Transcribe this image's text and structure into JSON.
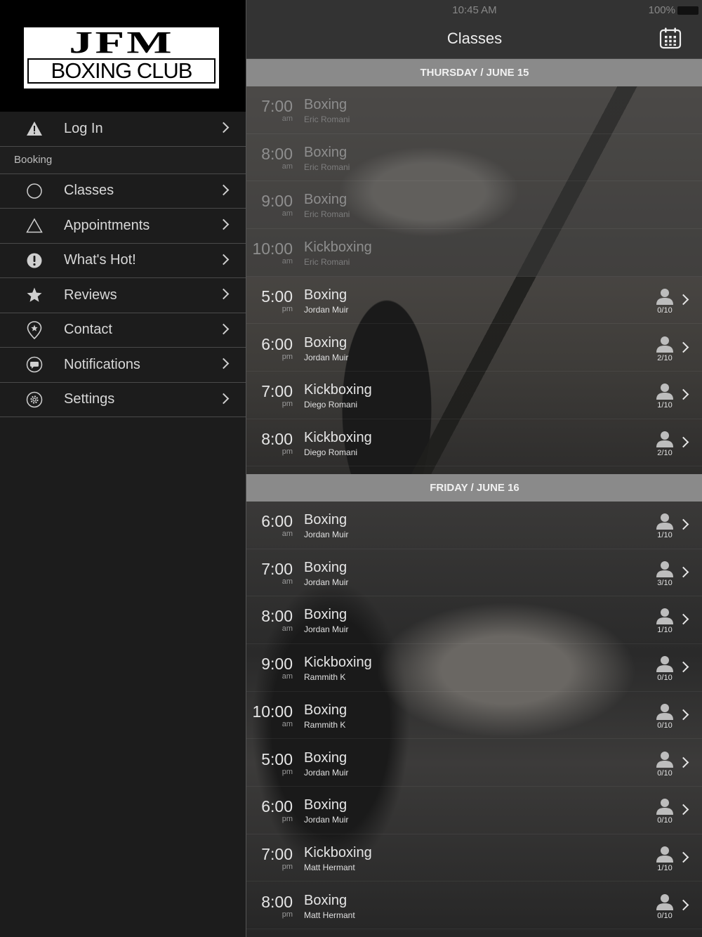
{
  "status_bar": {
    "time": "10:45 AM",
    "battery": "100%"
  },
  "sidebar": {
    "logo": {
      "line1": "JFM",
      "line2": "BOXING CLUB"
    },
    "login": {
      "label": "Log In",
      "icon": "warning-icon"
    },
    "section_label": "Booking",
    "items": [
      {
        "label": "Classes",
        "icon": "circle-icon"
      },
      {
        "label": "Appointments",
        "icon": "triangle-icon"
      },
      {
        "label": "What's Hot!",
        "icon": "exclamation-icon"
      },
      {
        "label": "Reviews",
        "icon": "star-icon"
      },
      {
        "label": "Contact",
        "icon": "map-pin-icon"
      },
      {
        "label": "Notifications",
        "icon": "chat-bubble-icon"
      },
      {
        "label": "Settings",
        "icon": "gear-icon"
      }
    ]
  },
  "main": {
    "title": "Classes",
    "days": [
      {
        "header": "THURSDAY / JUNE 15",
        "classes": [
          {
            "time": "7:00",
            "ampm": "am",
            "name": "Boxing",
            "instructor": "Eric Romani",
            "past": true
          },
          {
            "time": "8:00",
            "ampm": "am",
            "name": "Boxing",
            "instructor": "Eric Romani",
            "past": true
          },
          {
            "time": "9:00",
            "ampm": "am",
            "name": "Boxing",
            "instructor": "Eric Romani",
            "past": true
          },
          {
            "time": "10:00",
            "ampm": "am",
            "name": "Kickboxing",
            "instructor": "Eric Romani",
            "past": true
          },
          {
            "time": "5:00",
            "ampm": "pm",
            "name": "Boxing",
            "instructor": "Jordan Muir",
            "booked": "0/10"
          },
          {
            "time": "6:00",
            "ampm": "pm",
            "name": "Boxing",
            "instructor": "Jordan Muir",
            "booked": "2/10"
          },
          {
            "time": "7:00",
            "ampm": "pm",
            "name": "Kickboxing",
            "instructor": "Diego Romani",
            "booked": "1/10"
          },
          {
            "time": "8:00",
            "ampm": "pm",
            "name": "Kickboxing",
            "instructor": "Diego Romani",
            "booked": "2/10"
          }
        ]
      },
      {
        "header": "FRIDAY / JUNE 16",
        "classes": [
          {
            "time": "6:00",
            "ampm": "am",
            "name": "Boxing",
            "instructor": "Jordan Muir",
            "booked": "1/10"
          },
          {
            "time": "7:00",
            "ampm": "am",
            "name": "Boxing",
            "instructor": "Jordan Muir",
            "booked": "3/10"
          },
          {
            "time": "8:00",
            "ampm": "am",
            "name": "Boxing",
            "instructor": "Jordan Muir",
            "booked": "1/10"
          },
          {
            "time": "9:00",
            "ampm": "am",
            "name": "Kickboxing",
            "instructor": "Rammith K",
            "booked": "0/10"
          },
          {
            "time": "10:00",
            "ampm": "am",
            "name": "Boxing",
            "instructor": "Rammith K",
            "booked": "0/10"
          },
          {
            "time": "5:00",
            "ampm": "pm",
            "name": "Boxing",
            "instructor": "Jordan Muir",
            "booked": "0/10"
          },
          {
            "time": "6:00",
            "ampm": "pm",
            "name": "Boxing",
            "instructor": "Jordan Muir",
            "booked": "0/10"
          },
          {
            "time": "7:00",
            "ampm": "pm",
            "name": "Kickboxing",
            "instructor": "Matt Hermant",
            "booked": "1/10"
          },
          {
            "time": "8:00",
            "ampm": "pm",
            "name": "Boxing",
            "instructor": "Matt Hermant",
            "booked": "0/10"
          }
        ]
      }
    ]
  }
}
